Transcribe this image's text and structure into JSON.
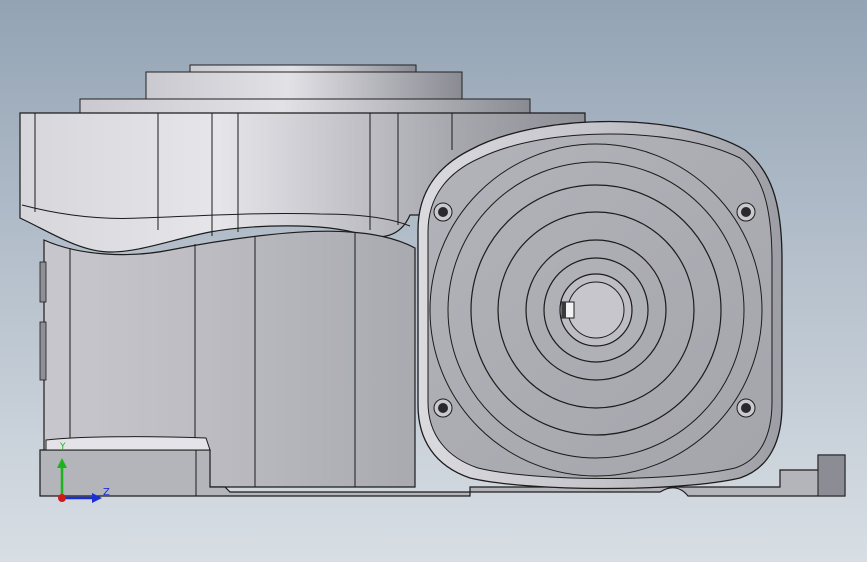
{
  "viewport": {
    "background_top": "#93a3b4",
    "background_bottom": "#d8dee4"
  },
  "model": {
    "body_color": "#b9b9bf",
    "edge_color": "#1c1c1c"
  },
  "triad": {
    "y_label": "Y",
    "z_label": "Z",
    "y_color": "#1bb51b",
    "z_color": "#1a2fd6",
    "x_color": "#d01818"
  }
}
